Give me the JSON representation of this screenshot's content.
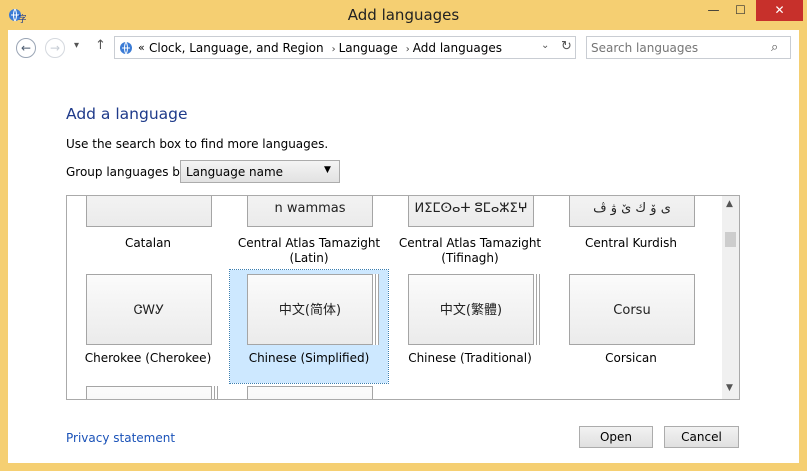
{
  "window": {
    "title": "Add languages",
    "controls": {
      "minimize": "—",
      "maximize": "☐",
      "close": "✕"
    }
  },
  "nav": {
    "back": "←",
    "forward": "→",
    "recent": "▾",
    "up": "↑",
    "crumbs_prefix": "«",
    "crumbs": [
      "Clock, Language, and Region",
      "Language",
      "Add languages"
    ],
    "crumb_sep": "›",
    "dropdown": "⌄",
    "refresh": "↻"
  },
  "search": {
    "placeholder": "Search languages",
    "icon": "⌕"
  },
  "content": {
    "heading": "Add a language",
    "instructions": "Use the search box to find more languages.",
    "group_label": "Group languages by:",
    "group_value": "Language name",
    "group_arrow": "▼"
  },
  "tiles": [
    {
      "script": "",
      "label": "Catalan",
      "selected": false
    },
    {
      "script": "n wammas",
      "label": "Central Atlas Tamazight\n(Latin)",
      "selected": false
    },
    {
      "script": "ⵍⵉⵎⵙⴰⵜ ⵓⵎⴰⵣⵉⵖ",
      "label": "Central Atlas Tamazight\n(Tifinagh)",
      "selected": false
    },
    {
      "script": "ی ۆ ك ێ ۋ ڤ",
      "label": "Central Kurdish",
      "selected": false
    },
    {
      "script": "ᏣᎳᎩ",
      "label": "Cherokee (Cherokee)",
      "selected": false
    },
    {
      "script": "中文(简体)",
      "label": "Chinese (Simplified)",
      "selected": true
    },
    {
      "script": "中文(繁體)",
      "label": "Chinese (Traditional)",
      "selected": false
    },
    {
      "script": "Corsu",
      "label": "Corsican",
      "selected": false
    }
  ],
  "scrollbar": {
    "up": "▲",
    "down": "▼"
  },
  "footer": {
    "privacy": "Privacy statement",
    "open": "Open",
    "cancel": "Cancel"
  }
}
